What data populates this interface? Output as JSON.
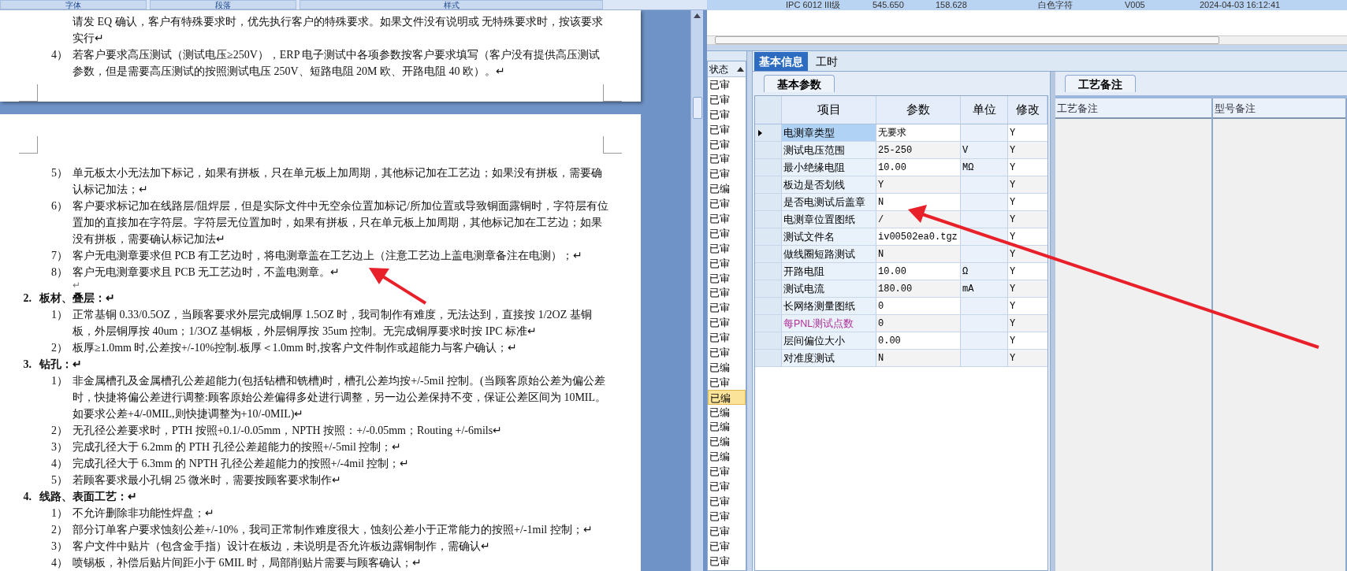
{
  "word": {
    "ribbon_groups": [
      "字体",
      "段落",
      "样式"
    ],
    "page1": [
      {
        "text": "请发 EQ 确认，客户有特殊要求时，优先执行客户的特殊要求。如果文件没有说明或 无特殊要求时，按该要求实行↵"
      },
      {
        "number": "4）",
        "text": "若客户要求高压测试（测试电压≥250V），ERP 电子测试中各项参数按客户要求填写（客户没有提供高压测试参数，但是需要高压测试的按照测试电压 250V、短路电阻 20M 欧、开路电阻 40 欧）。↵"
      }
    ],
    "page2": [
      {
        "kind": "item",
        "number": "5）",
        "text": "单元板太小无法加下标记，如果有拼板，只在单元板上加周期，其他标记加在工艺边；如果没有拼板，需要确认标记加法；↵"
      },
      {
        "kind": "item",
        "number": "6）",
        "text": "客户要求标记加在线路层/阻焊层，但是实际文件中无空余位置加标记/所加位置或导致铜面露铜时，字符层有位置加的直接加在字符层。字符层无位置加时，如果有拼板，只在单元板上加周期，其他标记加在工艺边；如果没有拼板，需要确认标记加法↵"
      },
      {
        "kind": "item",
        "number": "7）",
        "text": "客户无电测章要求但 PCB 有工艺边时，将电测章盖在工艺边上（注意工艺边上盖电测章备注在电测）；↵"
      },
      {
        "kind": "item",
        "number": "8）",
        "text": "客户无电测章要求且 PCB 无工艺边时，不盖电测章。↵"
      },
      {
        "kind": "blank",
        "text": "↵"
      },
      {
        "kind": "heading",
        "number": "2.",
        "text": "板材、叠层：↵"
      },
      {
        "kind": "item",
        "number": "1）",
        "text": "正常基铜 0.33/0.5OZ，当顾客要求外层完成铜厚 1.5OZ 时，我司制作有难度，无法达到，直接按 1/2OZ 基铜板，外层铜厚按 40um；1/3OZ 基铜板，外层铜厚按 35um 控制。无完成铜厚要求时按 IPC 标准↵"
      },
      {
        "kind": "item",
        "number": "2）",
        "text": "板厚≥1.0mm 时,公差按+/-10%控制.板厚＜1.0mm 时,按客户文件制作或超能力与客户确认；↵"
      },
      {
        "kind": "heading",
        "number": "3.",
        "text": "钻孔：↵"
      },
      {
        "kind": "item",
        "number": "1）",
        "text": "非金属槽孔及金属槽孔公差超能力(包括钻槽和铣槽)时，槽孔公差均按+/-5mil 控制。(当顾客原始公差为偏公差时，快捷将偏公差进行调整:顾客原始公差偏得多处进行调整，另一边公差保持不变，保证公差区间为 10MIL。如要求公差+4/-0MIL,则快捷调整为+10/-0MIL)↵"
      },
      {
        "kind": "item",
        "number": "2）",
        "text": "无孔径公差要求时，PTH 按照+0.1/-0.05mm，NPTH 按照：+/-0.05mm；Routing +/-6mils↵"
      },
      {
        "kind": "item",
        "number": "3）",
        "text": "完成孔径大于 6.2mm 的 PTH 孔径公差超能力的按照+/-5mil 控制；↵"
      },
      {
        "kind": "item",
        "number": "4）",
        "text": "完成孔径大于 6.3mm 的 NPTH 孔径公差超能力的按照+/-4mil 控制；↵"
      },
      {
        "kind": "item",
        "number": "5）",
        "text": "若顾客要求最小孔铜 25 微米时，需要按顾客要求制作↵"
      },
      {
        "kind": "heading",
        "number": "4.",
        "text": "线路、表面工艺：↵"
      },
      {
        "kind": "item",
        "number": "1）",
        "text": "不允许删除非功能性焊盘；↵"
      },
      {
        "kind": "item",
        "number": "2）",
        "text": "部分订单客户要求蚀刻公差+/-10%，我司正常制作难度很大，蚀刻公差小于正常能力的按照+/-1mil 控制；↵"
      },
      {
        "kind": "item",
        "number": "3）",
        "text": "客户文件中贴片（包含金手指）设计在板边，未说明是否允许板边露铜制作，需确认↵"
      },
      {
        "kind": "item",
        "number": "4）",
        "text": "喷锡板，补偿后贴片间距小于 6MIL 时，局部削贴片需要与顾客确认；↵"
      }
    ]
  },
  "app": {
    "top_row": [
      "IPC 6012 III级",
      "545.650",
      "158.628",
      "白色字符",
      "V005",
      "2024-04-03 16:12:41"
    ],
    "status_list": {
      "header": "状态",
      "items": [
        {
          "text": "已审",
          "selected": false
        },
        {
          "text": "已审",
          "selected": false
        },
        {
          "text": "已审",
          "selected": false
        },
        {
          "text": "已审",
          "selected": false
        },
        {
          "text": "已审",
          "selected": false
        },
        {
          "text": "已审",
          "selected": false
        },
        {
          "text": "已审",
          "selected": false
        },
        {
          "text": "已编",
          "selected": false
        },
        {
          "text": "已审",
          "selected": false
        },
        {
          "text": "已审",
          "selected": false
        },
        {
          "text": "已审",
          "selected": false
        },
        {
          "text": "已审",
          "selected": false
        },
        {
          "text": "已审",
          "selected": false
        },
        {
          "text": "已审",
          "selected": false
        },
        {
          "text": "已审",
          "selected": false
        },
        {
          "text": "已审",
          "selected": false
        },
        {
          "text": "已审",
          "selected": false
        },
        {
          "text": "已审",
          "selected": false
        },
        {
          "text": "已审",
          "selected": false
        },
        {
          "text": "已编",
          "selected": false
        },
        {
          "text": "已审",
          "selected": false
        },
        {
          "text": "已编",
          "selected": true
        },
        {
          "text": "已编",
          "selected": false
        },
        {
          "text": "已编",
          "selected": false
        },
        {
          "text": "已编",
          "selected": false
        },
        {
          "text": "已编",
          "selected": false
        },
        {
          "text": "已审",
          "selected": false
        },
        {
          "text": "已审",
          "selected": false
        },
        {
          "text": "已审",
          "selected": false
        },
        {
          "text": "已审",
          "selected": false
        },
        {
          "text": "已审",
          "selected": false
        },
        {
          "text": "已审",
          "selected": false
        },
        {
          "text": "已审",
          "selected": false
        }
      ]
    },
    "tabs": [
      {
        "label": "基本信息",
        "selected": true
      },
      {
        "label": "工时",
        "selected": false
      }
    ],
    "params": {
      "tab": "基本参数",
      "columns": [
        "项目",
        "参数",
        "单位",
        "修改"
      ],
      "rows": [
        {
          "item": "电测章类型",
          "value": "无要求",
          "unit": "",
          "modify": "Y",
          "selected": true,
          "emphasis": false
        },
        {
          "item": "测试电压范围",
          "value": "25-250",
          "unit": "V",
          "modify": "Y",
          "selected": false,
          "emphasis": false
        },
        {
          "item": "最小绝缘电阻",
          "value": "10.00",
          "unit": "MΩ",
          "modify": "Y",
          "selected": false,
          "emphasis": false
        },
        {
          "item": "板边是否划线",
          "value": "Y",
          "unit": "",
          "modify": "Y",
          "selected": false,
          "emphasis": false
        },
        {
          "item": "是否电测试后盖章",
          "value": "N",
          "unit": "",
          "modify": "Y",
          "selected": false,
          "emphasis": false
        },
        {
          "item": "电测章位置图纸",
          "value": "/",
          "unit": "",
          "modify": "Y",
          "selected": false,
          "emphasis": false
        },
        {
          "item": "测试文件名",
          "value": "iv00502ea0.tgz",
          "unit": "",
          "modify": "Y",
          "selected": false,
          "emphasis": false
        },
        {
          "item": "做线圈短路测试",
          "value": "N",
          "unit": "",
          "modify": "Y",
          "selected": false,
          "emphasis": false
        },
        {
          "item": "开路电阻",
          "value": "10.00",
          "unit": "Ω",
          "modify": "Y",
          "selected": false,
          "emphasis": false
        },
        {
          "item": "测试电流",
          "value": "180.00",
          "unit": "mA",
          "modify": "Y",
          "selected": false,
          "emphasis": false
        },
        {
          "item": "长网络测量图纸",
          "value": "0",
          "unit": "",
          "modify": "Y",
          "selected": false,
          "emphasis": false
        },
        {
          "item": "每PNL测试点数",
          "value": "0",
          "unit": "",
          "modify": "Y",
          "selected": false,
          "emphasis": true
        },
        {
          "item": "层间偏位大小",
          "value": "0.00",
          "unit": "",
          "modify": "Y",
          "selected": false,
          "emphasis": false
        },
        {
          "item": "对准度测试",
          "value": "N",
          "unit": "",
          "modify": "Y",
          "selected": false,
          "emphasis": false
        }
      ]
    },
    "notes": {
      "tab": "工艺备注",
      "columns": [
        "工艺备注",
        "型号备注"
      ]
    }
  }
}
